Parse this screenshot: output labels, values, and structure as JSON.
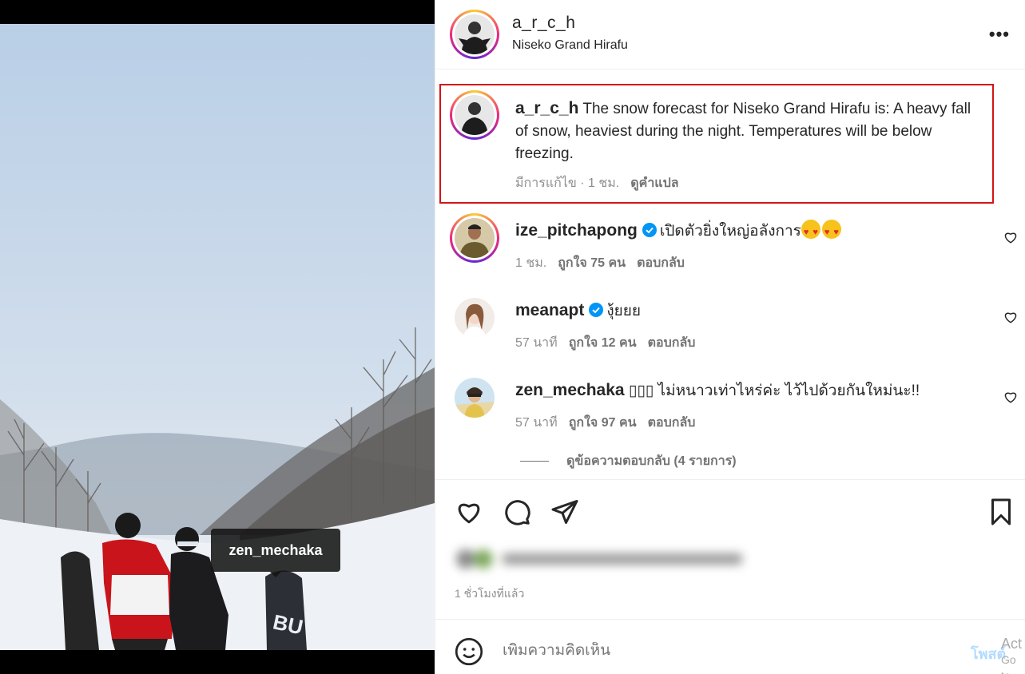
{
  "photo": {
    "tag_label": "zen_mechaka"
  },
  "header": {
    "username": "a_r_c_h",
    "location": "Niseko Grand Hirafu",
    "more_icon": "ellipsis-icon"
  },
  "caption": {
    "username": "a_r_c_h",
    "text": "The snow forecast for Niseko Grand Hirafu is: A heavy fall of snow, heaviest during the night. Temperatures will be below freezing.",
    "edited": "มีการแก้ไข · 1 ชม.",
    "translate": "ดูคำแปล"
  },
  "comments": [
    {
      "username": "ize_pitchapong",
      "verified": true,
      "text": "เปิดตัวยิ่งใหญ่อลังการ",
      "emoji_count": 2,
      "time": "1 ชม.",
      "likes": "ถูกใจ 75 คน",
      "reply": "ตอบกลับ"
    },
    {
      "username": "meanapt",
      "verified": true,
      "text": "งุ้ยยย",
      "time": "57 นาที",
      "likes": "ถูกใจ 12 คน",
      "reply": "ตอบกลับ"
    },
    {
      "username": "zen_mechaka",
      "verified": false,
      "text": "ไม่หนาวเท่าไหร่ค่ะ ไว้ไปด้วยกันใหม่นะ!!",
      "prefix_glyphs": "▯▯▯",
      "time": "57 นาที",
      "likes": "ถูกใจ 97 คน",
      "reply": "ตอบกลับ"
    }
  ],
  "view_replies": "ดูข้อความตอบกลับ (4 รายการ)",
  "actions": {
    "time_ago": "1 ชั่วโมงที่แล้ว"
  },
  "add_comment": {
    "placeholder": "เพิ่มความคิดเห็น",
    "post_label": "โพสต์"
  },
  "watermark": {
    "line1": "Act",
    "line2": "Go to"
  },
  "colors": {
    "highlight": "#d31515",
    "verified": "#0095f6",
    "post_disabled": "#b3dbff"
  }
}
